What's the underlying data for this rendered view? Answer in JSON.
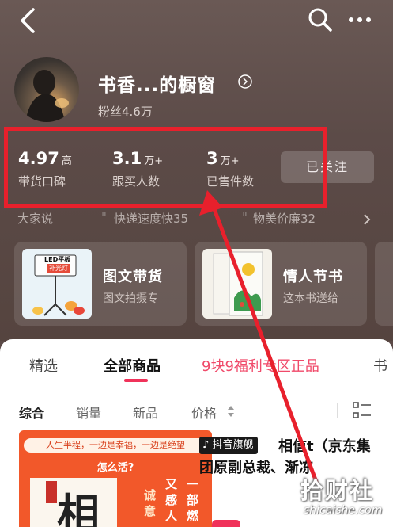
{
  "header": {
    "shop_name": "书香...的橱窗",
    "fans": "粉丝4.6万"
  },
  "stats": [
    {
      "value": "4.97",
      "unit": "高",
      "label": "带货口碑"
    },
    {
      "value": "3.1",
      "unit": "万+",
      "label": "跟买人数"
    },
    {
      "value": "3",
      "unit": "万+",
      "label": "已售件数"
    }
  ],
  "follow_button": "已关注",
  "reviews": {
    "label": "大家说",
    "tags": [
      "快递速度快35",
      "物美价廉32"
    ]
  },
  "feature_cards": [
    {
      "title": "图文带货",
      "subtitle": "图文拍摄专",
      "thumb_text": [
        "LED平板",
        "补光灯"
      ]
    },
    {
      "title": "情人节书",
      "subtitle": "这本书送给"
    }
  ],
  "tabs": [
    "精选",
    "全部商品",
    "9块9福利专区正品",
    "书"
  ],
  "active_tab": "全部商品",
  "sort_options": [
    "综合",
    "销量",
    "新品",
    "价格"
  ],
  "product": {
    "slogan": "人生半程，一边是幸福，一边是绝望",
    "slogan_question": "怎么活?",
    "book_char": "相",
    "vertical_text_1": "一部燃",
    "vertical_text_2": "又感人",
    "vertical_text_3": "诚意",
    "badge": "抖音旗舰",
    "title": "相信t（京东集团原副总裁、渐冻"
  },
  "watermark": {
    "cn": "拾财社",
    "en": "shicaishe.com"
  },
  "colors": {
    "accent": "#f0325a",
    "highlight_red": "#e8202c"
  }
}
